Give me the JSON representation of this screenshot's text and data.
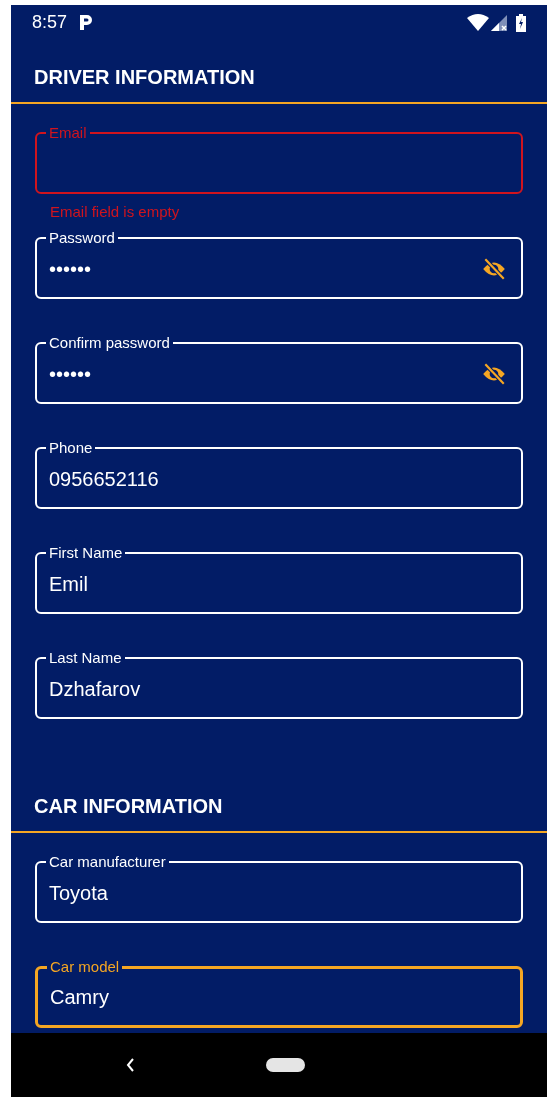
{
  "status_bar": {
    "time": "8:57"
  },
  "sections": [
    {
      "title": "DRIVER INFORMATION",
      "fields": [
        {
          "label": "Email",
          "invalid": true,
          "focused": false,
          "error": "Email field is empty"
        },
        {
          "label": "Password",
          "value": "••••••",
          "invalid": false,
          "focused": false,
          "kind": "password",
          "password_visible": false
        },
        {
          "label": "Confirm password",
          "value": "••••••",
          "invalid": false,
          "focused": false,
          "kind": "password",
          "password_visible": false
        },
        {
          "label": "Phone",
          "value": "0956652116",
          "invalid": false,
          "focused": false
        },
        {
          "label": "First Name",
          "value": "Emil",
          "invalid": false,
          "focused": false
        },
        {
          "label": "Last Name",
          "value": "Dzhafarov",
          "invalid": false,
          "focused": false
        }
      ]
    },
    {
      "title": "CAR INFORMATION",
      "fields": [
        {
          "label": "Car manufacturer",
          "value": "Toyota",
          "invalid": false,
          "focused": false
        },
        {
          "label": "Car model",
          "value": "Camry",
          "invalid": false,
          "focused": true
        }
      ]
    }
  ]
}
